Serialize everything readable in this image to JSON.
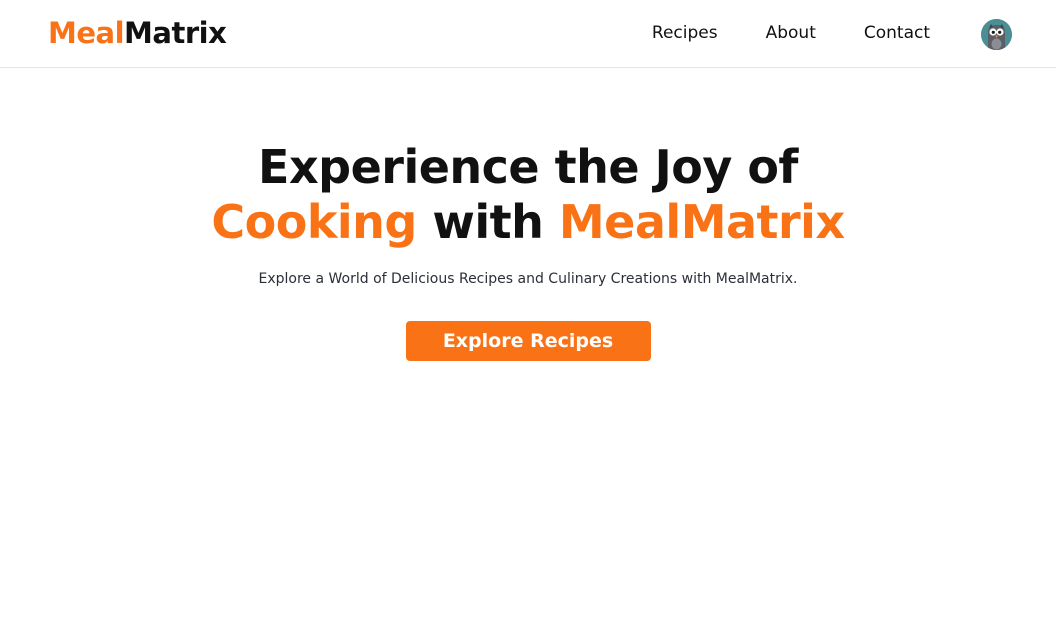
{
  "brand": {
    "part1": "Meal",
    "part2": "Matrix",
    "accent_color": "#f97316"
  },
  "nav": {
    "links": [
      {
        "label": "Recipes"
      },
      {
        "label": "About"
      },
      {
        "label": "Contact"
      }
    ],
    "avatar_icon": "owl-avatar-icon"
  },
  "hero": {
    "title_line1": "Experience the Joy of",
    "title_word1": "Cooking",
    "title_word2": "with",
    "title_word3": "MealMatrix",
    "subtitle": "Explore a World of Delicious Recipes and Culinary Creations with MealMatrix.",
    "cta_label": "Explore Recipes"
  }
}
